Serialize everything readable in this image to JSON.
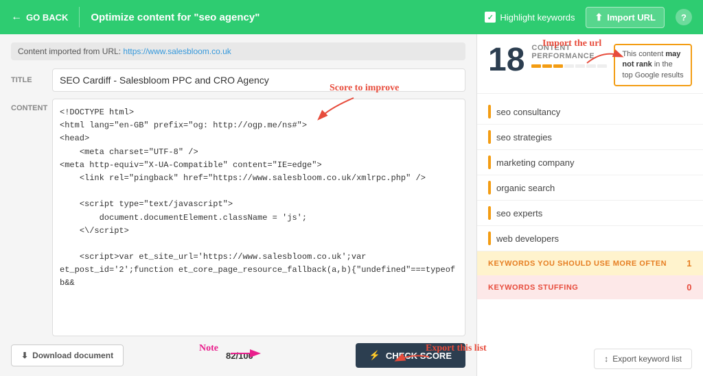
{
  "header": {
    "go_back": "GO BACK",
    "title_prefix": "Optimize content for ",
    "title_keyword": "\"seo agency\"",
    "highlight_label": "Highlight keywords",
    "import_url": "Import URL",
    "help": "?"
  },
  "url_bar": {
    "prefix": "Content imported from URL: ",
    "url": "https://www.salesbloom.co.uk"
  },
  "title_field": {
    "label": "TITLE",
    "value": "SEO Cardiff - Salesbloom PPC and CRO Agency"
  },
  "content_field": {
    "label": "CONTENT",
    "text": "<!DOCTYPE html>\n<html lang=\"en-GB\" prefix=\"og: http://ogp.me/ns#\">\n<head>\n    <meta charset=\"UTF-8\" />\n<meta http-equiv=\"X-UA-Compatible\" content=\"IE=edge\">\n    <link rel=\"pingback\" href=\"https://www.salesbloom.co.uk/xmlrpc.php\" />\n\n    <script type=\"text/javascript\">\n        document.documentElement.className = 'js';\n    <\\/script>\n\n    <script>var et_site_url='https://www.salesbloom.co.uk';var et_post_id='2';function et_core_page_resource_fallback(a,b){\"undefined\"===typeof b&&"
  },
  "bottom_bar": {
    "download": "Download document",
    "score_display": "82/100",
    "check_score": "CHECK SCORE"
  },
  "right_panel": {
    "score_number": "18",
    "score_label": "CONTENT PERFORMANCE",
    "not_rank_text1": "This content ",
    "not_rank_bold": "may not rank",
    "not_rank_text2": " in the top Google results",
    "keywords": [
      {
        "text": "seo consultancy",
        "indicator": "yellow"
      },
      {
        "text": "seo strategies",
        "indicator": "yellow"
      },
      {
        "text": "marketing company",
        "indicator": "yellow"
      },
      {
        "text": "organic search",
        "indicator": "yellow"
      },
      {
        "text": "seo experts",
        "indicator": "yellow"
      },
      {
        "text": "web developers",
        "indicator": "yellow"
      }
    ],
    "should_use_label": "KEYWORDS YOU SHOULD USE MORE OFTEN",
    "should_use_count": "1",
    "stuffing_label": "KEYWORDS STUFFING",
    "stuffing_count": "0",
    "export_btn": "Export keyword list"
  },
  "annotations": {
    "import_url": "Import the url",
    "score_to_improve": "Score to improve",
    "note": "Note",
    "export_this_list": "Export this list"
  }
}
